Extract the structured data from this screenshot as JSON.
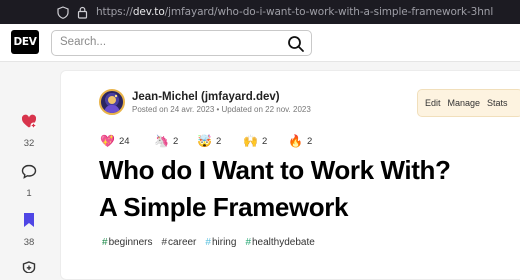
{
  "browser": {
    "url_domain": "dev.to",
    "url_path": "/jmfayard/who-do-i-want-to-work-with-a-simple-framework-3hnl",
    "url_prefix": "https://"
  },
  "header": {
    "logo": "DEV",
    "search_placeholder": "Search..."
  },
  "sidebar": {
    "reactions": [
      {
        "icon": "heart-plus-icon",
        "count": "32",
        "color": "#d8344c"
      },
      {
        "icon": "comment-icon",
        "count": "1",
        "color": "#333333"
      },
      {
        "icon": "bookmark-icon",
        "count": "38",
        "color": "#4f46e5"
      }
    ]
  },
  "article": {
    "author": "Jean-Michel (jmfayard.dev)",
    "posted": "Posted on 24 avr. 2023 • Updated on 22 nov. 2023",
    "actions": [
      "Edit",
      "Manage",
      "Stats"
    ],
    "reactions": [
      {
        "emoji": "💖",
        "count": "24"
      },
      {
        "emoji": "🦄",
        "count": "2"
      },
      {
        "emoji": "🤯",
        "count": "2"
      },
      {
        "emoji": "🙌",
        "count": "2"
      },
      {
        "emoji": "🔥",
        "count": "2"
      }
    ],
    "title_line1": "Who do I Want to Work With?",
    "title_line2": "A Simple Framework",
    "tags": [
      {
        "hash": "#",
        "name": "beginners",
        "color": "#1e8a4a"
      },
      {
        "hash": "#",
        "name": "career",
        "color": "#444444"
      },
      {
        "hash": "#",
        "name": "hiring",
        "color": "#5bc0de"
      },
      {
        "hash": "#",
        "name": "healthydebate",
        "color": "#2aa876"
      }
    ]
  }
}
